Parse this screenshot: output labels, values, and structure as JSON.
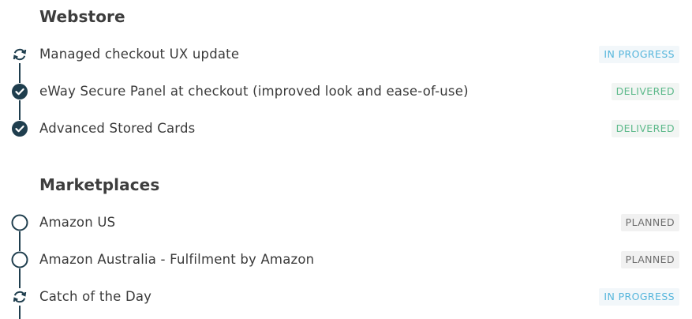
{
  "sections": [
    {
      "title": "Webstore",
      "items": [
        {
          "label": "Managed checkout UX update",
          "status": "IN PROGRESS",
          "icon": "refresh-icon"
        },
        {
          "label": "eWay Secure Panel at checkout (improved look and ease-of-use)",
          "status": "DELIVERED",
          "icon": "check-circle-icon"
        },
        {
          "label": "Advanced Stored Cards",
          "status": "DELIVERED",
          "icon": "check-circle-icon"
        }
      ]
    },
    {
      "title": "Marketplaces",
      "items": [
        {
          "label": "Amazon US",
          "status": "PLANNED",
          "icon": "empty-circle-icon"
        },
        {
          "label": "Amazon Australia - Fulfilment by Amazon",
          "status": "PLANNED",
          "icon": "empty-circle-icon"
        },
        {
          "label": "Catch of the Day",
          "status": "IN PROGRESS",
          "icon": "refresh-icon"
        }
      ]
    }
  ],
  "colors": {
    "timeline": "#1f3e4e",
    "in_progress": "#56b6dc",
    "delivered": "#5cb98a",
    "planned": "#6e6e6e"
  }
}
